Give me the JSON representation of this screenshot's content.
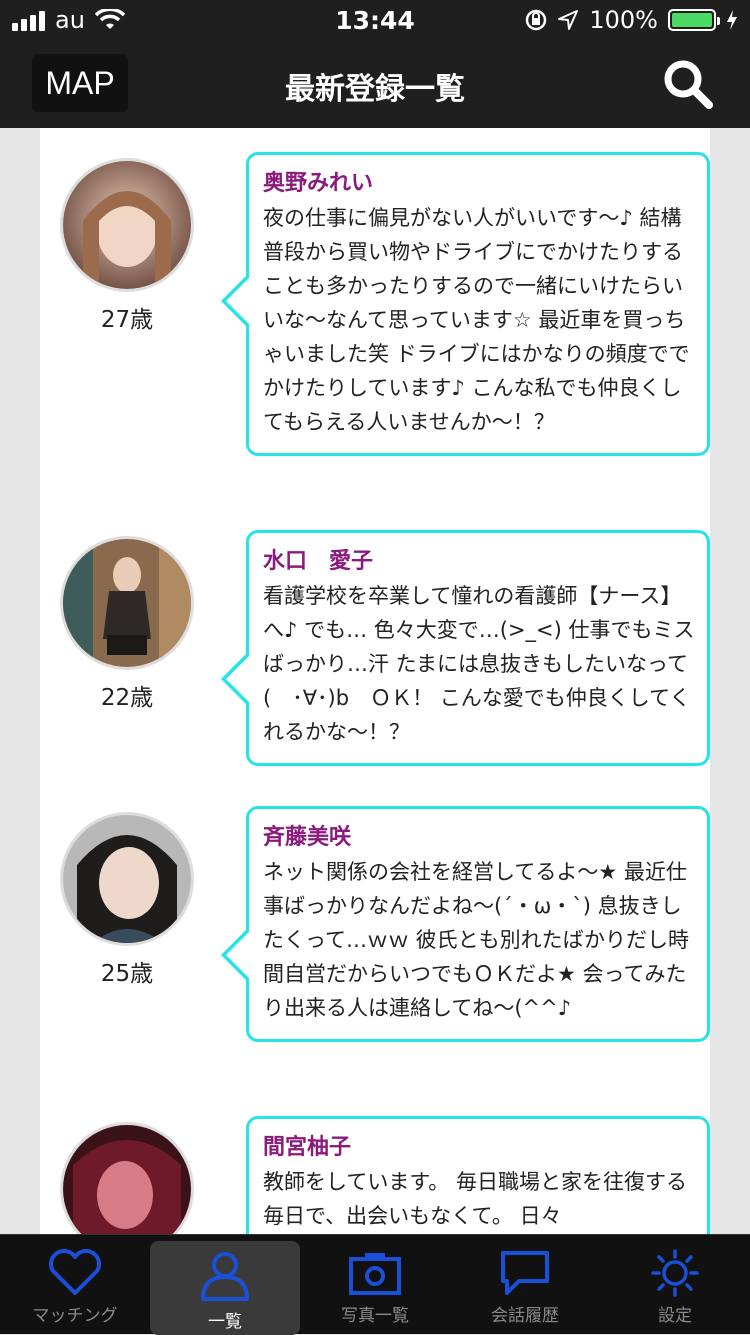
{
  "status_bar": {
    "carrier": "au",
    "time": "13:44",
    "battery_percent": "100%",
    "battery_level": 1.0
  },
  "header": {
    "map_label": "MAP",
    "title": "最新登録一覧",
    "search_icon": "search-icon"
  },
  "profiles": [
    {
      "name": "奥野みれい",
      "age": "27歳",
      "message": "夜の仕事に偏見がない人がいいです～♪ 結構普段から買い物やドライブにでかけたりすることも多かったりするので一緒にいけたらいいな～なんて思っています☆ 最近車を買っちゃいました笑 ドライブにはかなりの頻度ででかけたりしています♪ こんな私でも仲良くしてもらえる人いませんか～！？",
      "avatar_colors": [
        "#c9a18a",
        "#6b4a3e"
      ]
    },
    {
      "name": "水口　愛子",
      "age": "22歳",
      "message": "看護学校を卒業して憧れの看護師【ナース】へ♪ でも… 色々大変で…(>_<) 仕事でもミスばっかり…汗 たまには息抜きもしたいなって(　･∀･)b　ＯＫ！ こんな愛でも仲良くしてくれるかな～！？",
      "avatar_colors": [
        "#a07a58",
        "#3b3a36"
      ]
    },
    {
      "name": "斉藤美咲",
      "age": "25歳",
      "message": "ネット関係の会社を経営してるよ～★ 最近仕事ばっかりなんだよね～(´・ω・`) 息抜きしたくって…ｗｗ 彼氏とも別れたばかりだし時間自営だからいつでもＯＫだよ★ 会ってみたり出来る人は連絡してね～(^^♪",
      "avatar_colors": [
        "#b8b8b8",
        "#2c3a44"
      ]
    },
    {
      "name": "間宮柚子",
      "age": "",
      "message": "教師をしています。 毎日職場と家を往復する毎日で、出会いもなくて。 日々",
      "avatar_colors": [
        "#c23a4a",
        "#3a1218"
      ]
    }
  ],
  "tabs": [
    {
      "label": "マッチング",
      "icon": "heart-icon",
      "active": false
    },
    {
      "label": "一覧",
      "icon": "person-icon",
      "active": true
    },
    {
      "label": "写真一覧",
      "icon": "camera-icon",
      "active": false
    },
    {
      "label": "会話履歴",
      "icon": "chat-bubble-icon",
      "active": false
    },
    {
      "label": "設定",
      "icon": "sun-gear-icon",
      "active": false
    }
  ],
  "colors": {
    "bubble_border": "#25e3e6",
    "name_color": "#8b1a7e",
    "tab_icon": "#1a4fd8",
    "header_bg": "#1f1f1f"
  }
}
